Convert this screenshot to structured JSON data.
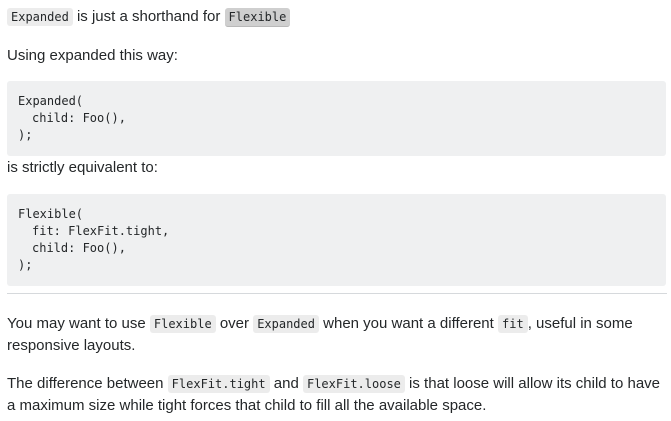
{
  "p1": {
    "code1": "Expanded",
    "text": " is just a shorthand for ",
    "code2": "Flexible"
  },
  "p2": {
    "text": "Using expanded this way:"
  },
  "code_block_1": {
    "line1": "Expanded(",
    "line2": "child: Foo(),",
    "line3": ");"
  },
  "p3": {
    "text": "is strictly equivalent to:"
  },
  "code_block_2": {
    "line1": "Flexible(",
    "line2": "fit: FlexFit.tight,",
    "line3": "child: Foo(),",
    "line4": ");"
  },
  "p4": {
    "t1": "You may want to use ",
    "c1": "Flexible",
    "t2": " over ",
    "c2": "Expanded",
    "t3": " when you want a different ",
    "c3": "fit",
    "t4": ", useful in some responsive layouts."
  },
  "p5": {
    "t1": "The difference between ",
    "c1": "FlexFit.tight",
    "t2": " and ",
    "c2": "FlexFit.loose",
    "t3": " is that loose will allow its child to have a maximum size while tight forces that child to fill all the available space."
  }
}
